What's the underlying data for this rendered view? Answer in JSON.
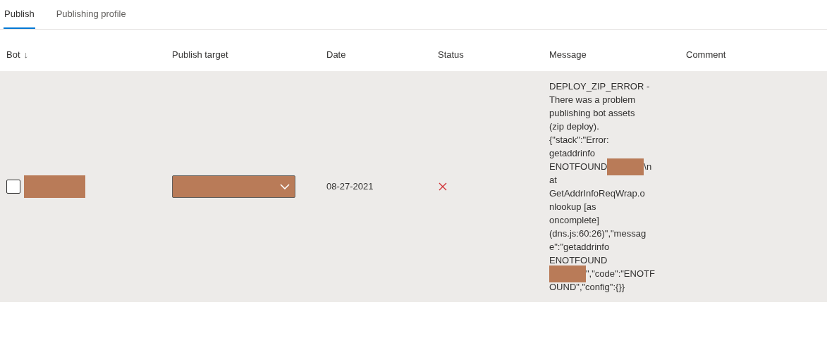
{
  "tabs": [
    {
      "label": "Publish",
      "selected": true
    },
    {
      "label": "Publishing profile",
      "selected": false
    }
  ],
  "table": {
    "columns": [
      {
        "label": "Bot",
        "sort": "↓"
      },
      {
        "label": "Publish target"
      },
      {
        "label": "Date"
      },
      {
        "label": "Status"
      },
      {
        "label": "Message"
      },
      {
        "label": "Comment"
      }
    ],
    "rows": [
      {
        "selected": true,
        "checked": false,
        "date": "08-27-2021",
        "failed": true,
        "message_lines": [
          [
            {
              "kind": "text",
              "text": "DEPLOY_ZIP_ERROR -"
            }
          ],
          [
            {
              "kind": "text",
              "text": "There was a problem"
            }
          ],
          [
            {
              "kind": "text",
              "text": "publishing bot assets"
            }
          ],
          [
            {
              "kind": "text",
              "text": "(zip deploy)."
            }
          ],
          [
            {
              "kind": "text",
              "text": "{\"stack\":\"Error:"
            }
          ],
          [
            {
              "kind": "text",
              "text": "getaddrinfo"
            }
          ],
          [
            {
              "kind": "text",
              "text": "ENOTFOUND"
            },
            {
              "kind": "redacted"
            },
            {
              "kind": "text",
              "text": "\\n"
            }
          ],
          [
            {
              "kind": "text",
              "text": "at"
            }
          ],
          [
            {
              "kind": "text",
              "text": "GetAddrInfoReqWrap.o"
            }
          ],
          [
            {
              "kind": "text",
              "text": "nlookup [as"
            }
          ],
          [
            {
              "kind": "text",
              "text": "oncomplete]"
            }
          ],
          [
            {
              "kind": "text",
              "text": "(dns.js:60:26)\",\"messag"
            }
          ],
          [
            {
              "kind": "text",
              "text": "e\":\"getaddrinfo"
            }
          ],
          [
            {
              "kind": "text",
              "text": "ENOTFOUND"
            }
          ],
          [
            {
              "kind": "redacted"
            },
            {
              "kind": "text",
              "text": "\",\"code\":\"ENOTF"
            }
          ],
          [
            {
              "kind": "text",
              "text": "OUND\",\"config\":{}}"
            }
          ]
        ]
      }
    ]
  }
}
